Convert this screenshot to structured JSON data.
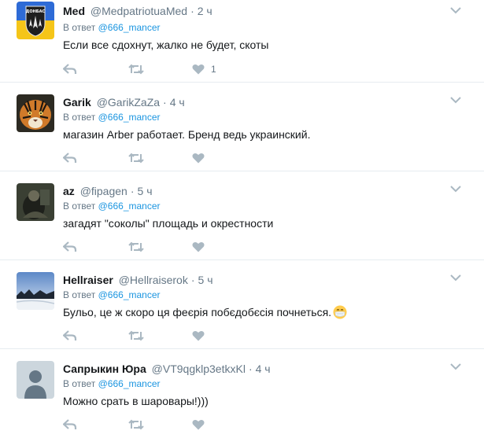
{
  "labels": {
    "in_reply_to": "В ответ"
  },
  "colors": {
    "link": "#1b95e0",
    "meta": "#657786",
    "icon": "#aab8c2"
  },
  "tweets": [
    {
      "name": "Med",
      "handle": "@MedpatriotuaMed",
      "time": "2 ч",
      "reply_to": "@666_mancer",
      "text": "Если все сдохнут, жалко не будет, скоты",
      "likes": "1",
      "avatar": "donbas-battalion-emblem",
      "avatar_text": "ДОНБАС"
    },
    {
      "name": "Garik",
      "handle": "@GarikZaZa",
      "time": "4 ч",
      "reply_to": "@666_mancer",
      "text": "магазин Arber работает. Бренд ведь украинский.",
      "likes": "",
      "avatar": "tiger-photo"
    },
    {
      "name": "az",
      "handle": "@fipagen",
      "time": "5 ч",
      "reply_to": "@666_mancer",
      "text": "загадят \"соколы\" площадь и окрестности",
      "likes": "",
      "avatar": "dark-photo"
    },
    {
      "name": "Hellraiser",
      "handle": "@Hellraiserok",
      "time": "5 ч",
      "reply_to": "@666_mancer",
      "text": "Бульо, це ж скоро ця феєрія побєдобєсія почнеться.",
      "likes": "",
      "avatar": "winter-landscape-photo",
      "emoji": "face-with-medical-mask"
    },
    {
      "name": "Сапрыкин Юра",
      "handle": "@VT9qgklp3etkxKl",
      "time": "4 ч",
      "reply_to": "@666_mancer",
      "text": "Можно срать в шаровары!)))",
      "likes": "",
      "avatar": "default-avatar"
    }
  ]
}
